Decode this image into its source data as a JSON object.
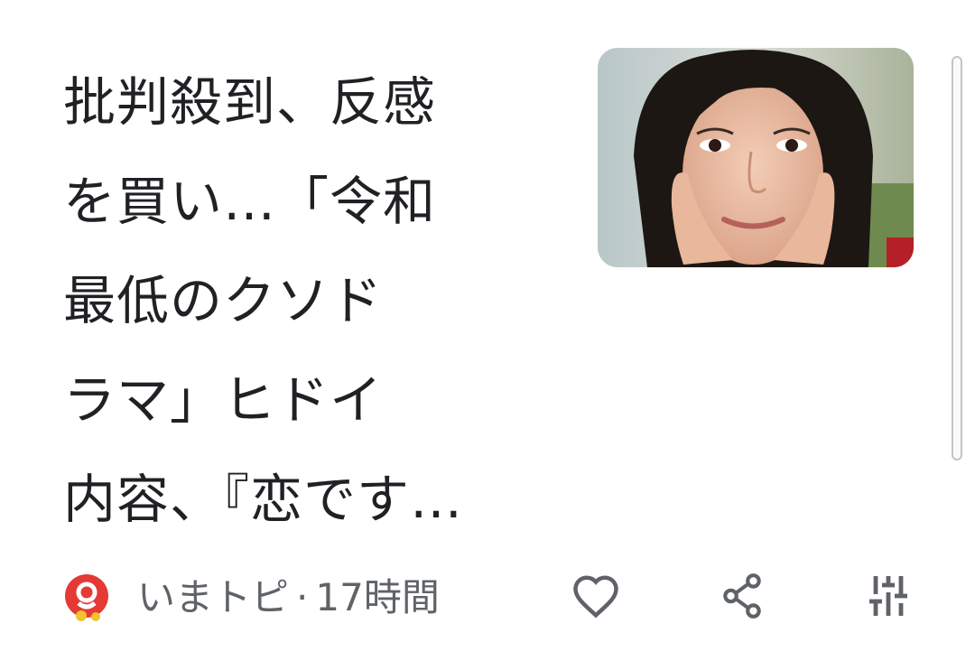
{
  "article": {
    "headline_lines": [
      "批判殺到、反感",
      "を買い…「令和",
      "最低のクソド",
      "ラマ」ヒドイ",
      "内容、『恋です…"
    ]
  },
  "source": {
    "name": "いまトピ",
    "separator": "·",
    "time_ago": "17時間",
    "logo_icon": "imatopi-logo-icon",
    "logo_color": "#e53935"
  },
  "actions": {
    "like_icon": "heart-icon",
    "share_icon": "share-icon",
    "more_icon": "tune-icon"
  },
  "colors": {
    "text": "#202124",
    "meta": "#5f6368",
    "icon": "#5f6368"
  }
}
